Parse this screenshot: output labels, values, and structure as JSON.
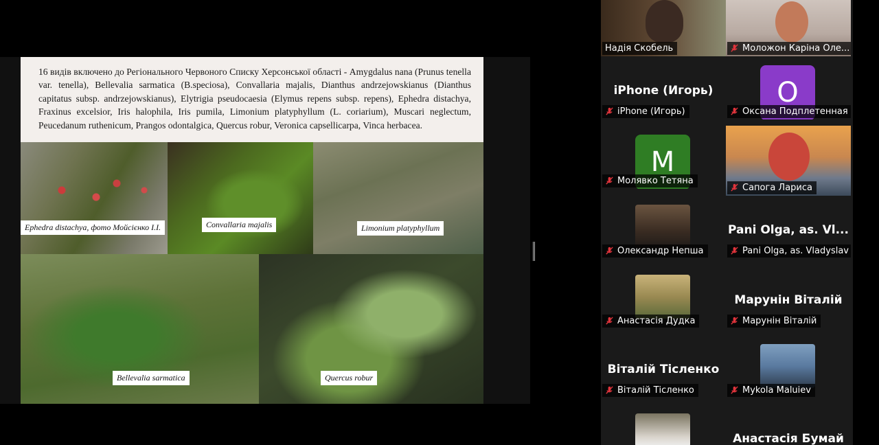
{
  "slide": {
    "text": "16 видів включено до Регіонального Червоного Списку Херсонської області - Amygdalus nana (Prunus tenella var. tenella), Bellevalia sarmatica (B.speciosa), Convallaria majalis, Dianthus andrzejowskianus (Dianthus capitatus subsp. andrzejowskianus), Elytrigia pseudocaesia (Elymus repens subsp. repens), Ephedra distachya, Fraxinus excelsior, Iris halophila, Iris pumila, Limonium platyphyllum (L. coriarium), Muscari neglectum, Peucedanum ruthenicum, Prangos odontalgica, Quercus robur, Veronica capsellicarpa, Vinca herbacea.",
    "captions": {
      "ephedra": "Ephedra distachya, фото Мойсієнко І.І.",
      "convallaria": "Convallaria majalis",
      "limonium": "Limonium platyphyllum",
      "bellevalia": "Bellevalia sarmatica",
      "quercus": "Quercus robur"
    }
  },
  "participants": {
    "nadia": {
      "name": "Надія Скобель"
    },
    "karina": {
      "name": "Моложон Каріна Оле..."
    },
    "iphone": {
      "big": "iPhone (Игорь)",
      "name": "iPhone (Игорь)"
    },
    "oksana": {
      "initial": "O",
      "name": "Оксана Подплетенная",
      "color": "#8a3bc9"
    },
    "tetiana": {
      "initial": "M",
      "name": "Молявко Тетяна",
      "color": "#2f7d24"
    },
    "larysa": {
      "name": "Сапога Лариса"
    },
    "oleksandr": {
      "name": "Олександр Непша"
    },
    "olga": {
      "big": "Pani Olga, as. Vl...",
      "name": "Pani Olga, as. Vladyslav"
    },
    "anastasia_d": {
      "name": "Анастасія Дудка"
    },
    "vitaliy_m": {
      "big": "Марунін Віталій",
      "name": "Марунін Віталій"
    },
    "vitaliy_t": {
      "big": "Віталій Тісленко",
      "name": "Віталій Тісленко"
    },
    "mykola": {
      "name": "Mykola Maluiev"
    },
    "anastasia_b": {
      "big": "Анастасія Бумай"
    }
  },
  "colors": {
    "active_speaker": "#2fd04f",
    "muted_icon": "#e0343c"
  }
}
